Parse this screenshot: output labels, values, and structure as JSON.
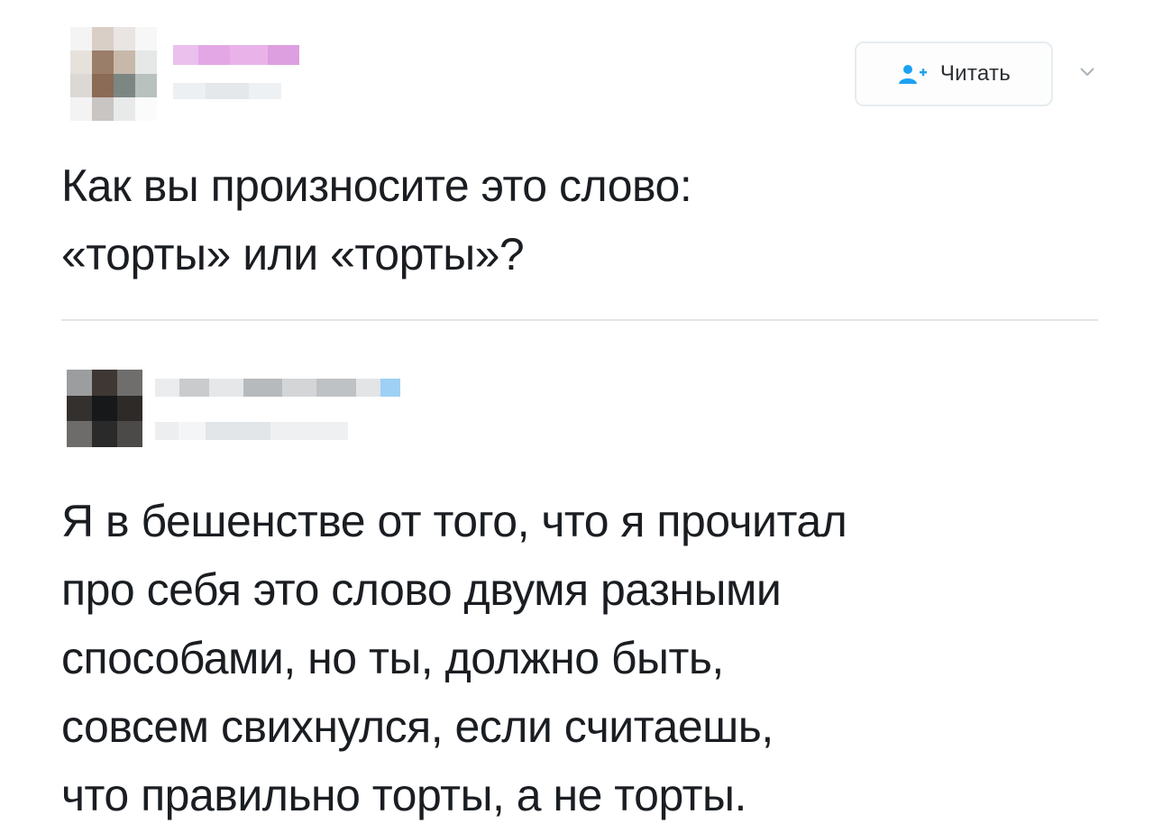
{
  "tweet": {
    "follow_button": {
      "label": "Читать",
      "icon": "person-add-icon"
    },
    "caret_icon": "chevron-down-icon",
    "text": "Как вы произносите это слово:\n«торты» или «торты»?"
  },
  "reply": {
    "text": "Я в бешенстве от того, что я прочитал\nпро себя это слово двумя разными\nспособами, но ты, должно быть,\nсовсем свихнулся, если считаешь,\nчто правильно торты, а не торты."
  },
  "colors": {
    "follow_icon_blue": "#1da1f2",
    "name_pink": "#e7a9e8",
    "verified_blue": "#9ed0f5",
    "divider": "#e1e6ea",
    "text": "#1a1d21"
  }
}
